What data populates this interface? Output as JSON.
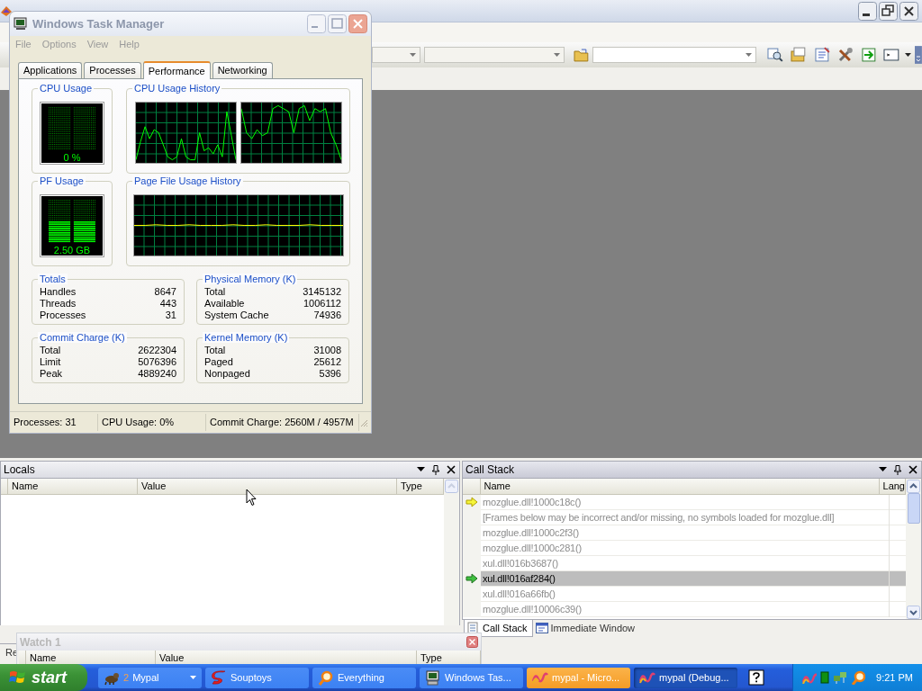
{
  "task_manager": {
    "title": "Windows Task Manager",
    "menu": [
      "File",
      "Options",
      "View",
      "Help"
    ],
    "tabs": [
      {
        "label": "Applications",
        "selected": false
      },
      {
        "label": "Processes",
        "selected": false
      },
      {
        "label": "Performance",
        "selected": true
      },
      {
        "label": "Networking",
        "selected": false
      }
    ],
    "cpu_usage": {
      "title": "CPU Usage",
      "reading": "0 %"
    },
    "cpu_usage_history": {
      "title": "CPU Usage History"
    },
    "pf_usage": {
      "title": "PF Usage",
      "reading": "2.50 GB"
    },
    "page_file_usage_history": {
      "title": "Page File Usage History"
    },
    "groups": [
      {
        "title": "Totals",
        "rows": [
          {
            "label": "Handles",
            "value": "8647"
          },
          {
            "label": "Threads",
            "value": "443"
          },
          {
            "label": "Processes",
            "value": "31"
          }
        ]
      },
      {
        "title": "Physical Memory (K)",
        "rows": [
          {
            "label": "Total",
            "value": "3145132"
          },
          {
            "label": "Available",
            "value": "1006112"
          },
          {
            "label": "System Cache",
            "value": "74936"
          }
        ]
      },
      {
        "title": "Commit Charge (K)",
        "rows": [
          {
            "label": "Total",
            "value": "2622304"
          },
          {
            "label": "Limit",
            "value": "5076396"
          },
          {
            "label": "Peak",
            "value": "4889240"
          }
        ]
      },
      {
        "title": "Kernel Memory (K)",
        "rows": [
          {
            "label": "Total",
            "value": "31008"
          },
          {
            "label": "Paged",
            "value": "25612"
          },
          {
            "label": "Nonpaged",
            "value": "5396"
          }
        ]
      }
    ],
    "status_bar": [
      "Processes: 31",
      "CPU Usage: 0%",
      "Commit Charge: 2560M / 4957M"
    ]
  },
  "locals": {
    "title": "Locals",
    "columns": [
      "Name",
      "Value",
      "Type"
    ]
  },
  "bottom_left_tabs": [
    "Re"
  ],
  "call_stack": {
    "title": "Call Stack",
    "columns": [
      "Name",
      "Lang"
    ],
    "rows": [
      {
        "name": "mozglue.dll!1000c18c()",
        "kind": "current",
        "selected": false
      },
      {
        "name": "[Frames below may be incorrect and/or missing, no symbols loaded for mozglue.dll]",
        "selected": false
      },
      {
        "name": "mozglue.dll!1000c2f3()",
        "selected": false
      },
      {
        "name": "mozglue.dll!1000c281()",
        "selected": false
      },
      {
        "name": "xul.dll!016b3687()",
        "selected": false
      },
      {
        "name": "xul.dll!016af284()",
        "kind": "frame",
        "selected": true
      },
      {
        "name": "xul.dll!016a66fb()",
        "selected": false
      },
      {
        "name": "mozglue.dll!10006c39()",
        "selected": false
      }
    ]
  },
  "bottom_right_tabs": [
    {
      "label": "Call Stack",
      "selected": true
    },
    {
      "label": "Immediate Window",
      "selected": false
    }
  ],
  "watch": {
    "title": "Watch 1",
    "columns": [
      "Name",
      "Value",
      "Type"
    ]
  },
  "taskbar": {
    "start": "start",
    "buttons": [
      {
        "count": "2",
        "label": "Mypal",
        "group": true,
        "selected": false,
        "flashing": false
      },
      {
        "label": "Souptoys",
        "selected": false,
        "flashing": false
      },
      {
        "label": "Everything",
        "selected": false,
        "flashing": false
      },
      {
        "label": "Windows Tas...",
        "selected": false,
        "flashing": false
      },
      {
        "label": "mypal - Micro...",
        "selected": false,
        "flashing": true
      },
      {
        "label": "mypal (Debug...",
        "selected": true,
        "flashing": false
      }
    ],
    "clock": "9:21 PM"
  }
}
